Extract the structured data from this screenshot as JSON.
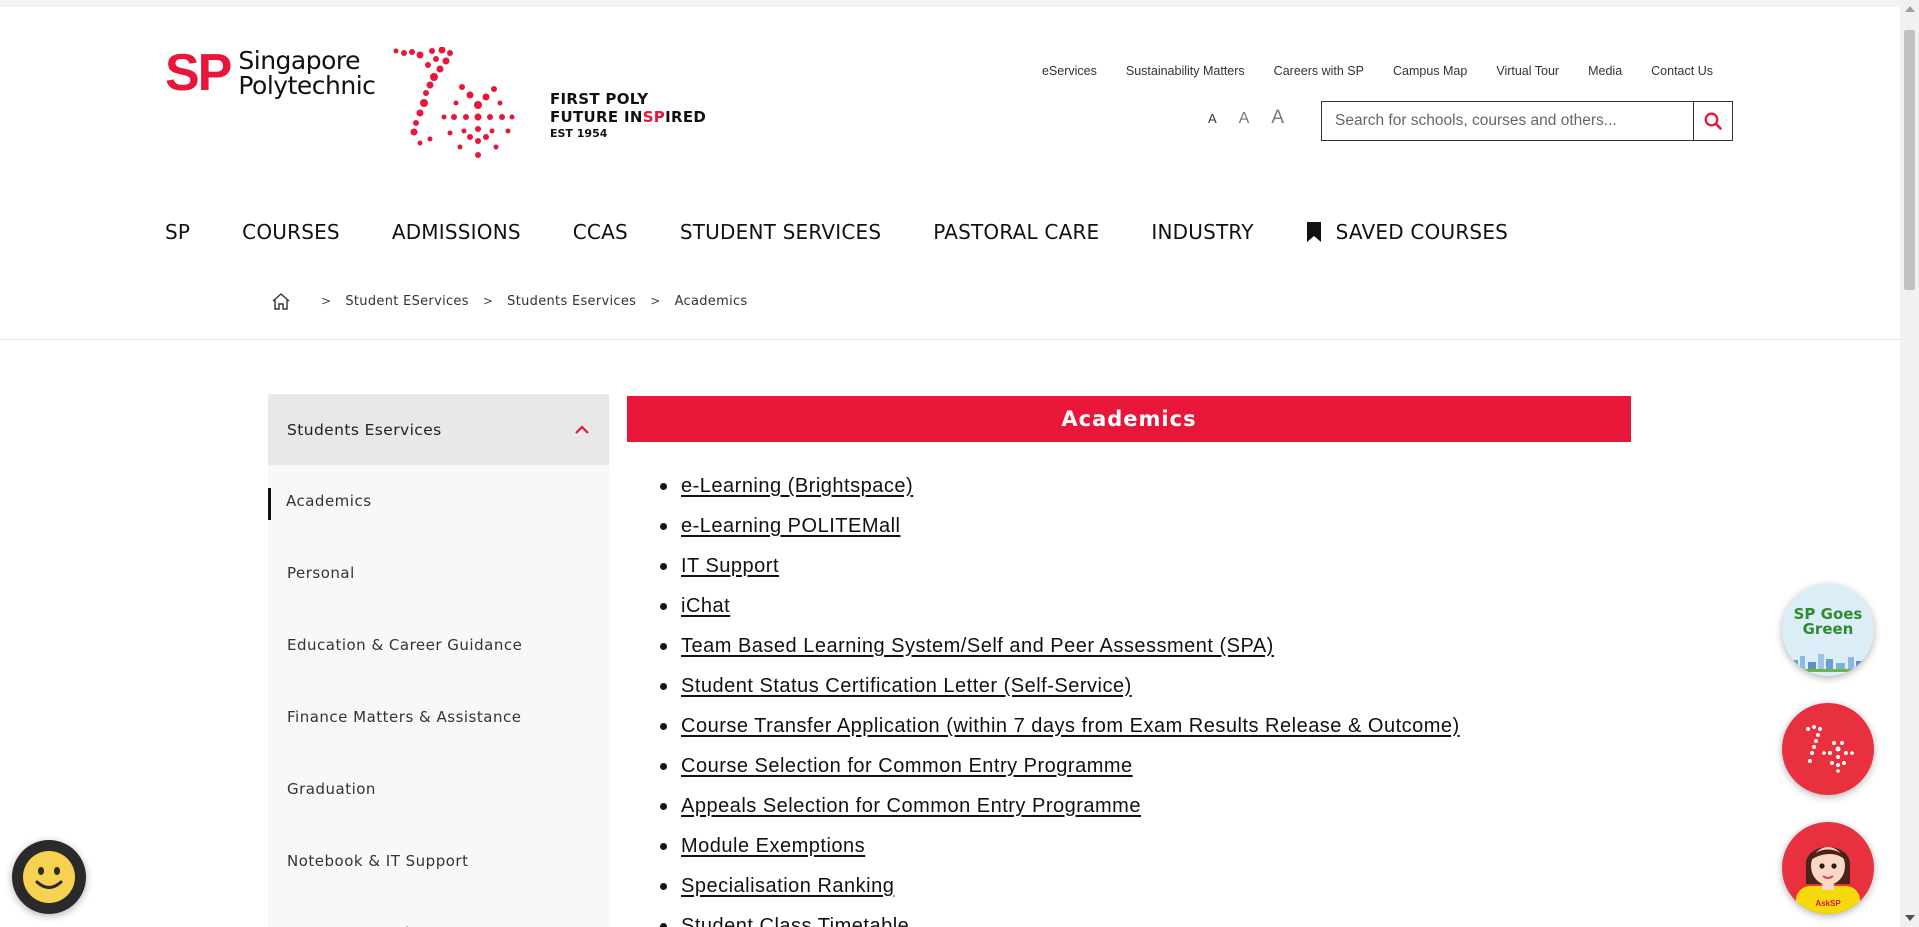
{
  "header": {
    "logo_abbrev": "SP",
    "logo_name_line1": "Singapore",
    "logo_name_line2": "Polytechnic",
    "tagline_line1": "FIRST POLY",
    "tagline_line2_a": "FUTURE IN",
    "tagline_line2_b": "SP",
    "tagline_line2_c": "IRED",
    "tagline_line3": "EST 1954",
    "utility_links": [
      "eServices",
      "Sustainability Matters",
      "Careers with SP",
      "Campus Map",
      "Virtual Tour",
      "Media",
      "Contact Us"
    ],
    "font_size_labels": [
      "A",
      "A",
      "A"
    ],
    "search_placeholder": "Search for schools, courses and others...",
    "brand_color": "#e8173a"
  },
  "main_nav": [
    "SP",
    "COURSES",
    "ADMISSIONS",
    "CCAS",
    "STUDENT SERVICES",
    "PASTORAL CARE",
    "INDUSTRY",
    "SAVED COURSES"
  ],
  "breadcrumb": {
    "sep": ">",
    "items": [
      "Student EServices",
      "Students Eservices",
      "Academics"
    ]
  },
  "sidebar": {
    "heading": "Students Eservices",
    "items": [
      "Academics",
      "Personal",
      "Education & Career Guidance",
      "Finance Matters & Assistance",
      "Graduation",
      "Notebook & IT Support",
      "For Future Students"
    ]
  },
  "content": {
    "title": "Academics",
    "links": [
      "e-Learning (Brightspace)",
      "e-Learning POLITEMall",
      "IT Support",
      "iChat",
      "Team Based Learning System/Self and Peer Assessment (SPA)",
      "Student Status Certification Letter (Self-Service)",
      "Course Transfer Application (within 7 days from Exam Results Release & Outcome)",
      "Course Selection for Common Entry Programme",
      "Appeals Selection for Common Entry Programme",
      "Module Exemptions",
      "Specialisation Ranking",
      "Student Class Timetable"
    ]
  },
  "floating": {
    "green_label_line1": "SP Goes",
    "green_label_line2": "Green",
    "ask_label": "AskSP"
  }
}
